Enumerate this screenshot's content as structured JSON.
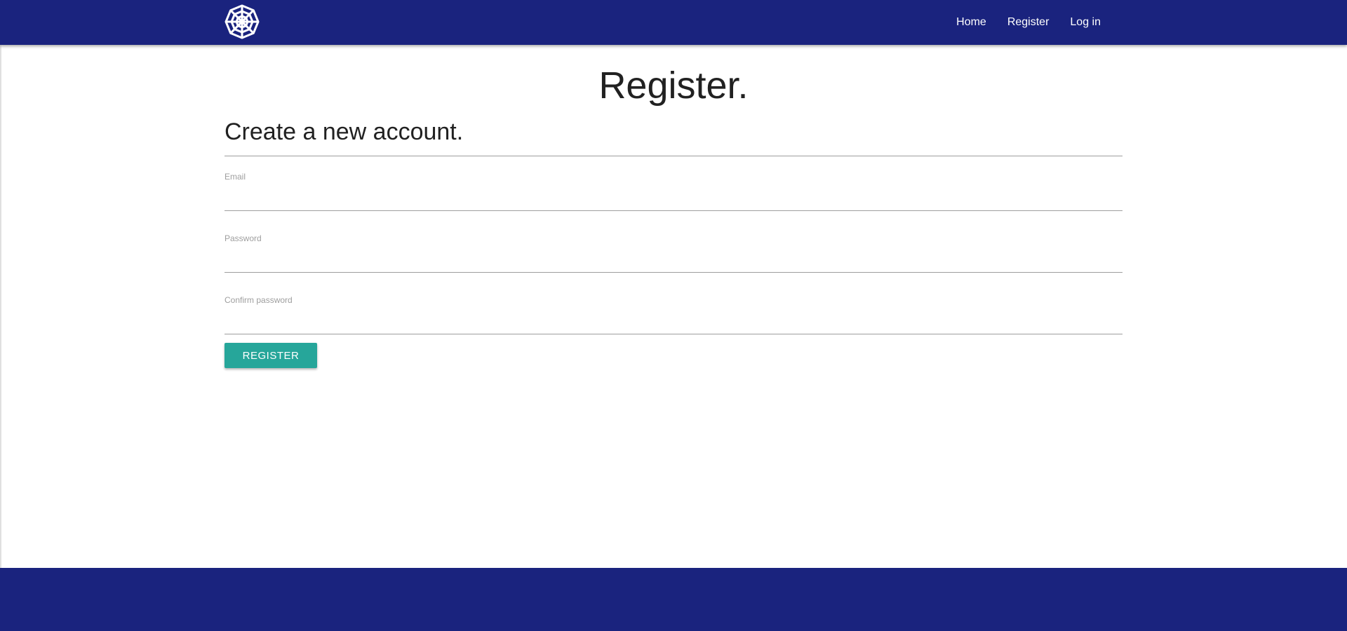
{
  "nav": {
    "logo_icon": "spider-web-icon",
    "links": [
      "Home",
      "Register",
      "Log in"
    ]
  },
  "main": {
    "title": "Register.",
    "subtitle": "Create a new account.",
    "fields": {
      "email": {
        "label": "Email",
        "value": ""
      },
      "password": {
        "label": "Password",
        "value": ""
      },
      "confirm": {
        "label": "Confirm password",
        "value": ""
      }
    },
    "submit_label": "REGISTER"
  },
  "colors": {
    "navbar": "#1a237e",
    "button": "#26a69a",
    "footer": "#1a237e"
  }
}
